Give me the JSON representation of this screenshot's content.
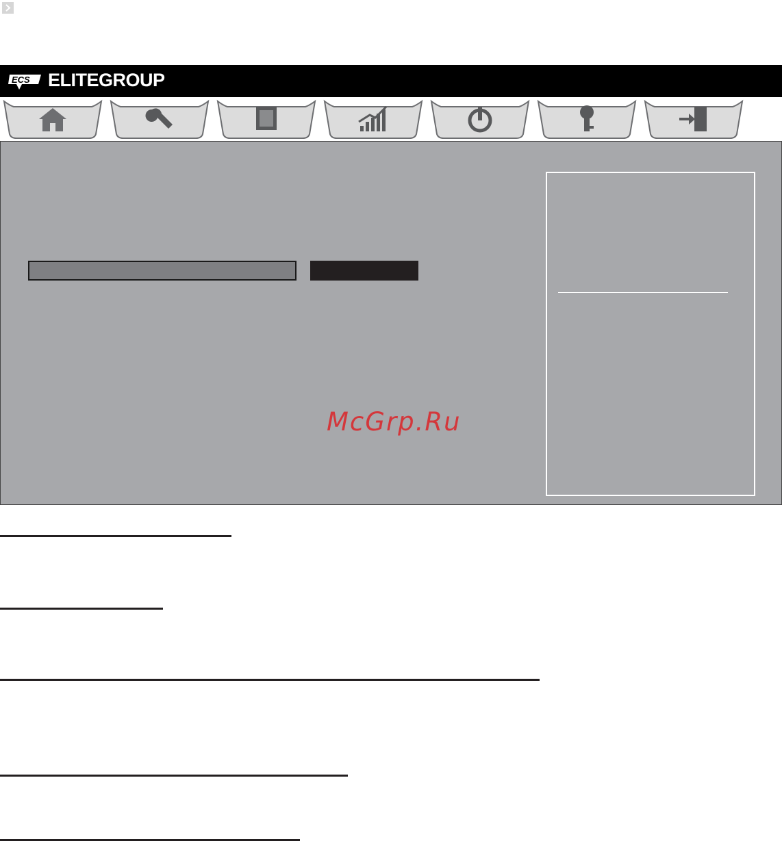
{
  "header": {
    "logo_name": "ecs-logo-icon",
    "brand": "ELITEGROUP"
  },
  "tabs": [
    {
      "name": "tab-main",
      "icon": "home-icon"
    },
    {
      "name": "tab-advanced",
      "icon": "wrench-icon"
    },
    {
      "name": "tab-chipset",
      "icon": "chip-icon"
    },
    {
      "name": "tab-mib",
      "icon": "performance-chart-icon"
    },
    {
      "name": "tab-boot",
      "icon": "power-icon"
    },
    {
      "name": "tab-security",
      "icon": "key-icon"
    },
    {
      "name": "tab-exit",
      "icon": "exit-door-icon"
    }
  ],
  "colors": {
    "panel": "#a7a8ab",
    "header": "#000000",
    "selected_bar": "#7f8083",
    "watermark": "#d4373b"
  },
  "watermark": "McGrp.Ru"
}
